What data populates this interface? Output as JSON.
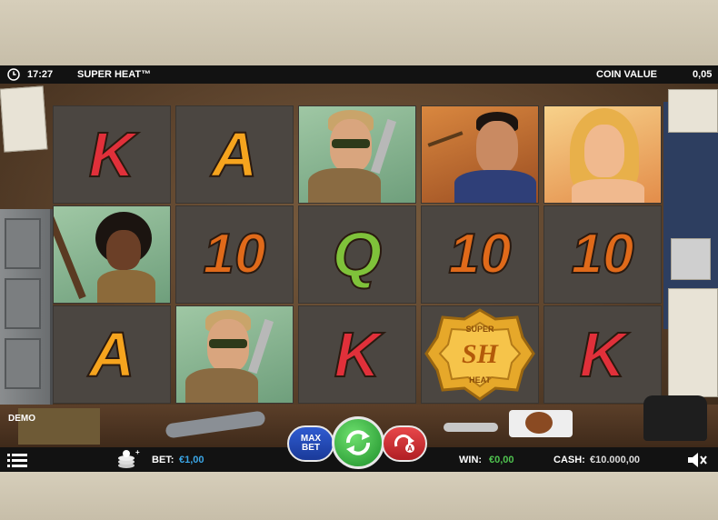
{
  "header": {
    "time": "17:27",
    "title": "SUPER HEAT™",
    "coin_value_label": "COIN VALUE",
    "coin_value": "0,05"
  },
  "reels": [
    [
      "K",
      "portrait-woman-afro",
      "A"
    ],
    [
      "A",
      "10",
      "portrait-sheriff"
    ],
    [
      "portrait-sheriff",
      "Q",
      "K"
    ],
    [
      "portrait-mobster",
      "10",
      "badge-wild"
    ],
    [
      "portrait-blonde",
      "10",
      "K"
    ]
  ],
  "badge": {
    "text": "SH",
    "top_text": "SUPER",
    "bottom_text": "HEAT"
  },
  "mode_label": "DEMO",
  "controls": {
    "max_bet_line1": "MAX",
    "max_bet_line2": "BET"
  },
  "footer": {
    "bet_label": "BET:",
    "bet_value": "€1,00",
    "win_label": "WIN:",
    "win_value": "€0,00",
    "cash_label": "CASH:",
    "cash_value": "€10.000,00"
  },
  "colors": {
    "bet_value": "#3ba6e6",
    "win_value": "#4fc24f",
    "spin_button": "#2aa33a",
    "max_bet_button": "#2f5bd1",
    "autoplay_button": "#d0292e"
  },
  "icons": [
    "clock-icon",
    "menu-icon",
    "coin-stack-icon",
    "spin-icon",
    "autoplay-icon",
    "sound-icon"
  ]
}
